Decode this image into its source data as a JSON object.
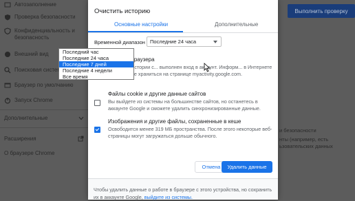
{
  "sidebar": {
    "items": [
      {
        "label": "Автозаполнение",
        "icon": "autofill-icon"
      },
      {
        "label": "Проверка безопасности",
        "icon": "shield-icon"
      },
      {
        "label": "Конфиденциальность и безопасность",
        "icon": "privacy-shield-icon"
      },
      {
        "label": "Внешний вид",
        "icon": "palette-icon"
      },
      {
        "label": "Поисковая система",
        "icon": "search-icon"
      },
      {
        "label": "Браузер по умолчанию",
        "icon": "browser-icon"
      },
      {
        "label": "Запуск Chrome",
        "icon": "power-icon"
      }
    ],
    "extra_label": "Дополнительные",
    "extensions_label": "Расширения",
    "about_label": "О браузере Chrome"
  },
  "background_right": {
    "verify_button": "Выполнить проверку",
    "text1": "и безопасности",
    "text2": "нты (например, есть",
    "text3": "ьзовательских данных"
  },
  "dialog": {
    "title": "Очистить историю",
    "tabs": [
      {
        "label": "Основные настройки"
      },
      {
        "label": "Дополнительные"
      }
    ],
    "time_range_label": "Временной диапазон",
    "time_range_value": "Последние 24 часа",
    "time_range_options": [
      "Последний час",
      "Последние 24 часа",
      "Последние 7 дней",
      "Последние 4 недели",
      "Все время"
    ],
    "time_range_highlighted": "Последние 7 дней",
    "options": [
      {
        "title": "История браузера",
        "desc": "Удаление истории с... выполнен вход в аккаунт. Информ... в Интернете может также храниться на странице myactivity.google.com.",
        "checked": false
      },
      {
        "title": "Файлы cookie и другие данные сайтов",
        "desc": "Вы выйдете из системы на большинстве сайтов, но останетесь в аккаунте Google и сможете удалить синхронизированные данные.",
        "checked": false
      },
      {
        "title": "Изображения и другие файлы, сохраненные в кеше",
        "desc": "Освободится менее 319 МБ пространства. После этого некоторые веб-страницы могут загружаться дольше обычного.",
        "checked": true
      }
    ],
    "cancel_label": "Отмена",
    "delete_label": "Удалить данные",
    "footer_text": "Чтобы удалить данные о работе в браузере с этого устройства, но сохранить их в аккаунте Google,",
    "footer_link": "выйдите из системы."
  }
}
